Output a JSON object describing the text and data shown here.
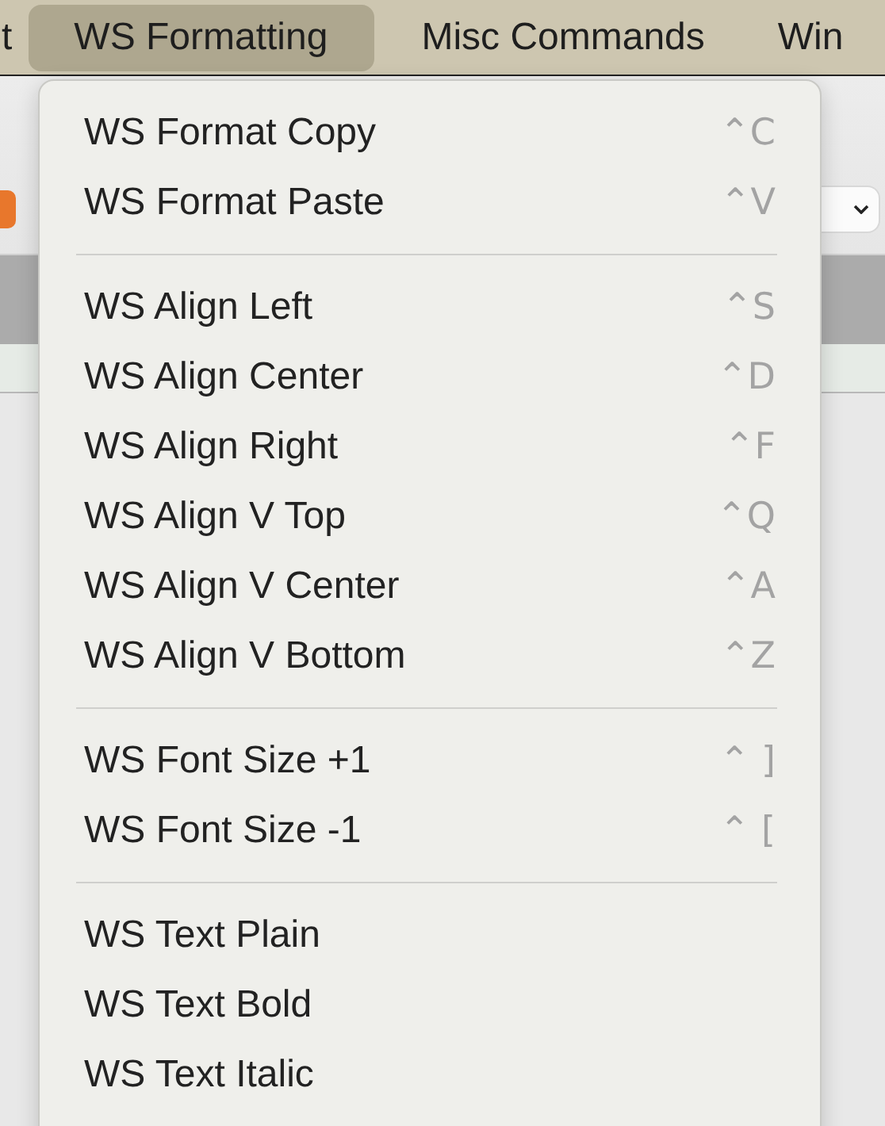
{
  "menu_bar": [
    {
      "label": "t",
      "selected": false
    },
    {
      "label": "WS Formatting",
      "selected": true
    },
    {
      "label": "Misc Commands",
      "selected": false
    },
    {
      "label": "Win",
      "selected": false
    }
  ],
  "menu": {
    "groups": [
      {
        "items": [
          {
            "label": "WS Format Copy",
            "shortcut": "⌃C"
          },
          {
            "label": "WS Format Paste",
            "shortcut": "⌃V"
          }
        ]
      },
      {
        "items": [
          {
            "label": "WS Align Left",
            "shortcut": "⌃S"
          },
          {
            "label": "WS Align Center",
            "shortcut": "⌃D"
          },
          {
            "label": "WS Align Right",
            "shortcut": "⌃F"
          },
          {
            "label": "WS Align V Top",
            "shortcut": "⌃Q"
          },
          {
            "label": "WS Align V Center",
            "shortcut": "⌃A"
          },
          {
            "label": "WS Align V Bottom",
            "shortcut": "⌃Z"
          }
        ]
      },
      {
        "items": [
          {
            "label": "WS Font Size +1",
            "shortcut": "⌃ ]"
          },
          {
            "label": "WS Font Size -1",
            "shortcut": "⌃ ["
          }
        ]
      },
      {
        "items": [
          {
            "label": "WS Text Plain"
          },
          {
            "label": "WS Text Bold"
          },
          {
            "label": "WS Text Italic"
          }
        ]
      }
    ]
  }
}
